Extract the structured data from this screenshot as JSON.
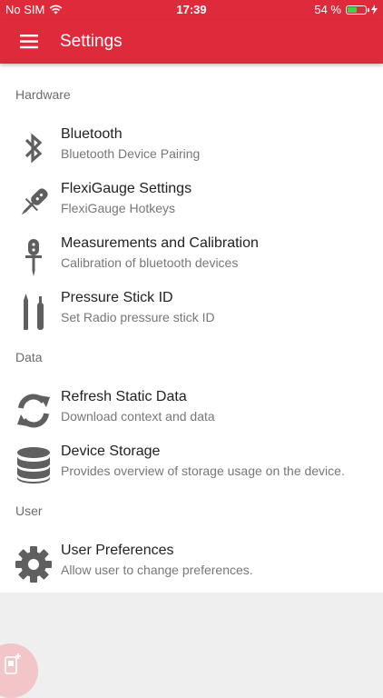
{
  "status_bar": {
    "carrier": "No SIM",
    "time": "17:39",
    "battery": "54 %",
    "battery_level": 0.54,
    "wifi_icon": "wifi-icon",
    "charging_icon": "bolt-icon"
  },
  "app_bar": {
    "title": "Settings",
    "menu_icon": "hamburger-menu-icon",
    "color": "#df2a3c"
  },
  "sections": {
    "hardware": {
      "header": "Hardware",
      "items": [
        {
          "title": "Bluetooth",
          "subtitle": "Bluetooth Device Pairing",
          "icon": "bluetooth-icon"
        },
        {
          "title": "FlexiGauge Settings",
          "subtitle": "FlexiGauge Hotkeys",
          "icon": "gauge-probe-icon"
        },
        {
          "title": "Measurements and Calibration",
          "subtitle": "Calibration of bluetooth devices",
          "icon": "calibration-probe-icon"
        },
        {
          "title": "Pressure Stick ID",
          "subtitle": "Set Radio pressure stick ID",
          "icon": "pressure-stick-icon"
        }
      ]
    },
    "data": {
      "header": "Data",
      "items": [
        {
          "title": "Refresh Static Data",
          "subtitle": "Download context and data",
          "icon": "refresh-icon"
        },
        {
          "title": "Device Storage",
          "subtitle": "Provides overview of storage usage on the device.",
          "icon": "database-icon"
        }
      ]
    },
    "user": {
      "header": "User",
      "items": [
        {
          "title": "User Preferences",
          "subtitle": "Allow user to change preferences.",
          "icon": "gear-icon"
        }
      ]
    }
  },
  "fab": {
    "icon": "add-device-icon",
    "color": "#f2c5c9"
  }
}
